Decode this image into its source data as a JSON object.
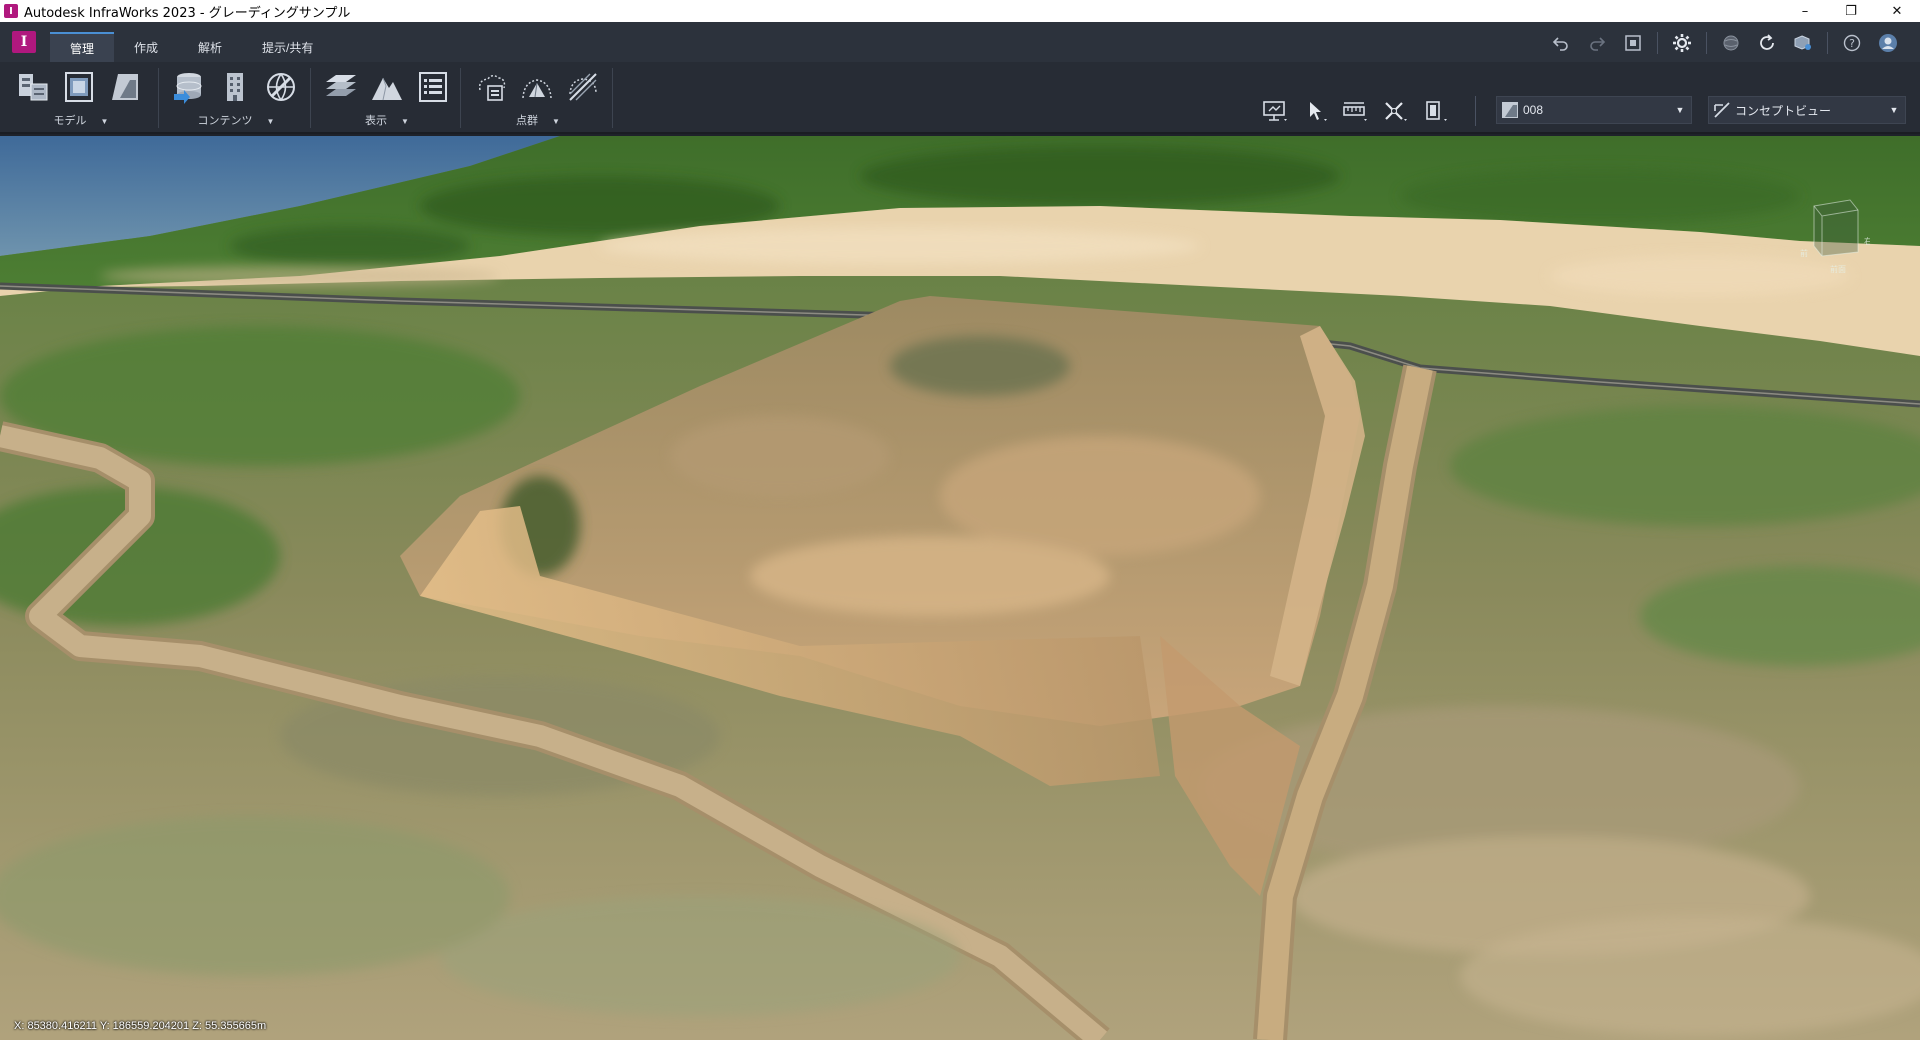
{
  "window": {
    "title": "Autodesk InfraWorks 2023 - グレーディングサンプル",
    "app_icon_letter": "I",
    "controls": {
      "minimize": "–",
      "restore": "❐",
      "close": "✕"
    }
  },
  "menu": {
    "logo_letter": "I",
    "tabs": [
      {
        "label": "管理",
        "active": true
      },
      {
        "label": "作成",
        "active": false
      },
      {
        "label": "解析",
        "active": false
      },
      {
        "label": "提示/共有",
        "active": false
      }
    ],
    "right_icons": [
      "undo-icon",
      "redo-icon",
      "fit-view-icon",
      "settings-icon",
      "globe-icon",
      "sync-icon",
      "cloud-model-icon",
      "help-icon",
      "user-avatar-icon"
    ]
  },
  "ribbon": {
    "groups": [
      {
        "label": "モデル",
        "icons": [
          "model-explorer-icon",
          "proposal-icon",
          "surface-layers-icon"
        ]
      },
      {
        "label": "コンテンツ",
        "icons": [
          "data-sources-icon",
          "building-icon",
          "cloud-globe-icon"
        ]
      },
      {
        "label": "表示",
        "icons": [
          "layers-icon",
          "terrain-icon",
          "list-icon"
        ]
      },
      {
        "label": "点群",
        "icons": [
          "point-cloud-icon",
          "point-cloud-terrain-icon",
          "point-cloud-clip-icon"
        ]
      }
    ],
    "view_tools": [
      "presentation-icon",
      "select-icon",
      "measure-icon",
      "cross-section-icon",
      "clip-icon"
    ],
    "proposal_combo": {
      "value": "008",
      "icon": "proposal-icon"
    },
    "style_combo": {
      "value": "コンセプトビュー",
      "icon": "visual-style-icon"
    }
  },
  "viewport": {
    "coordinates": "X: 85380.416211 Y: 186559.204201 Z: 55.355665m",
    "viewcube_labels": {
      "right": "右",
      "left": "前",
      "bottom": "前面"
    }
  },
  "colors": {
    "accent": "#b0187e",
    "tab_active_line": "#4a8fd4",
    "ribbon_bg": "#272c35",
    "menu_bg": "#2c323c"
  }
}
